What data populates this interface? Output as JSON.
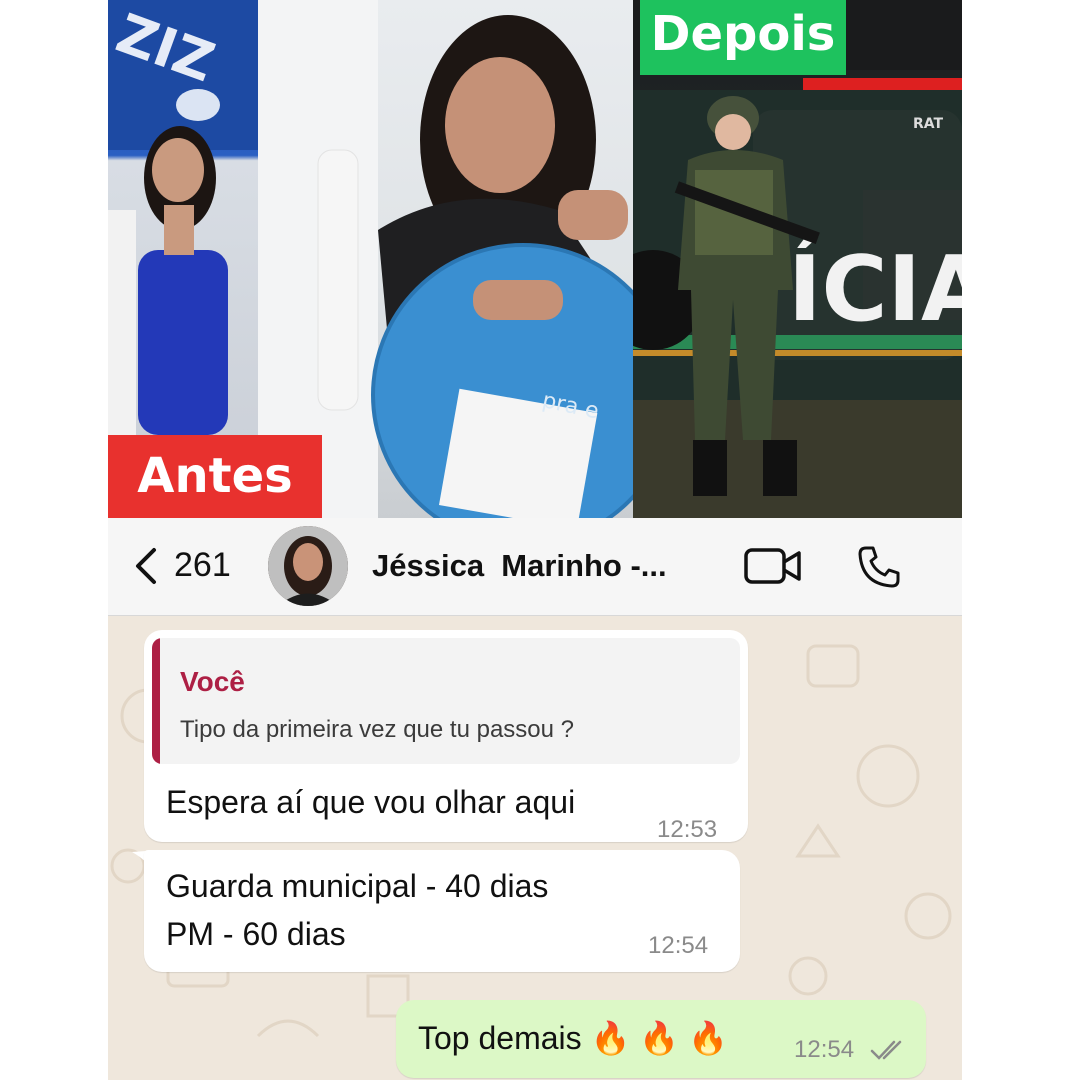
{
  "photos": {
    "before_label": "Antes",
    "after_label": "Depois",
    "table_text": "pra e",
    "vehicle_text": "ÍCIA",
    "vehicle_small_text": "RAT"
  },
  "header": {
    "back_count": "261",
    "contact_name": "Jéssica  Marinho -...",
    "icons": [
      "back-chevron-icon",
      "video-call-icon",
      "phone-call-icon"
    ]
  },
  "messages": [
    {
      "direction": "incoming",
      "quote_author": "Você",
      "quote_text": "Tipo da primeira vez que tu passou ?",
      "text": "Espera aí que vou olhar aqui",
      "time": "12:53"
    },
    {
      "direction": "incoming",
      "text": "Guarda municipal - 40 dias\nPM - 60 dias",
      "time": "12:54"
    },
    {
      "direction": "outgoing",
      "text": "Top demais 🔥 🔥 🔥",
      "time": "12:54",
      "status": "read"
    }
  ],
  "colors": {
    "before_badge": "#e8312e",
    "after_badge": "#1ec25e",
    "quote_accent": "#ad1f44",
    "outgoing_bubble": "#dcf8c6",
    "chat_background": "#efe7dc"
  }
}
